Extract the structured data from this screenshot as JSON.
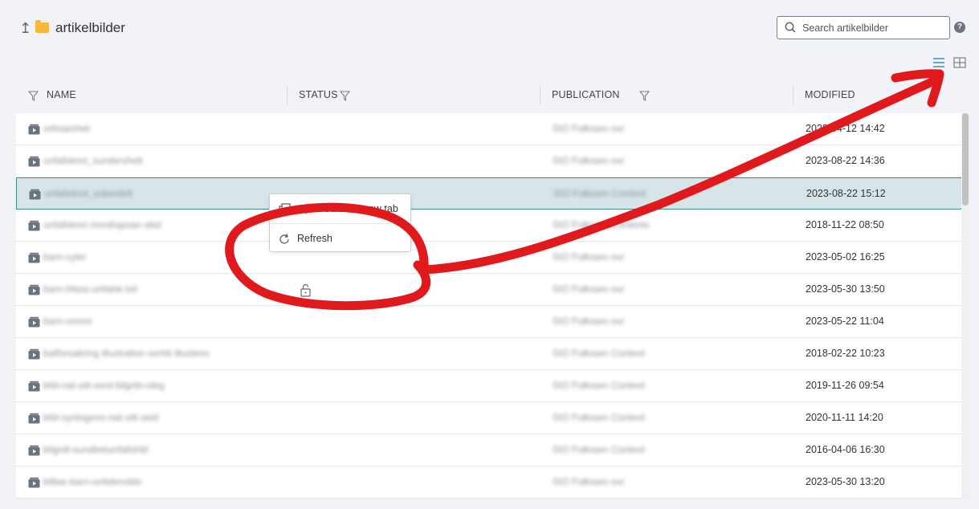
{
  "header": {
    "folder_title": "artikelbilder",
    "up_icon": "arrow-up-icon",
    "folder_icon": "folder-icon"
  },
  "search": {
    "placeholder": "Search artikelbilder",
    "value": ""
  },
  "toolbar": {
    "help_label": "?",
    "list_view_icon": "list-view-icon",
    "grid_view_icon": "grid-view-icon"
  },
  "columns": {
    "name": "NAME",
    "status": "STATUS",
    "publication": "PUBLICATION",
    "modified": "MODIFIED"
  },
  "rows": [
    {
      "name": "virksamhet",
      "publication": "SIO Folksam ovr",
      "modified": "2022-04-12 14:42"
    },
    {
      "name": "unfallskrot_sundervhelt",
      "publication": "SIO Folksam ovr",
      "modified": "2023-08-22 14:36"
    },
    {
      "name": "unfallskrot_sukerdelt",
      "publication": "SIO Folksam Content",
      "modified": "2023-08-22 15:12",
      "selected": true
    },
    {
      "name": "unfallskrot mordrapsan skid",
      "publication": "SIO Folksam Contents",
      "modified": "2018-11-22 08:50"
    },
    {
      "name": "barn-cyler",
      "publication": "SIO Folksam ovr",
      "modified": "2023-05-02 16:25"
    },
    {
      "name": "barn-hfass-unfalsk lsit",
      "publication": "SIO Folksam ovr",
      "modified": "2023-05-30 13:50"
    },
    {
      "name": "barn-vonmi",
      "publication": "SIO Folksam ovr",
      "modified": "2023-05-22 11:04"
    },
    {
      "name": "batforsakring illustration serhb illustens",
      "publication": "SIO Folksam Content",
      "modified": "2018-02-22 10:23"
    },
    {
      "name": "bild-nat-sitt-serd-bilgrbt-rdeg",
      "publication": "SIO Folksam Content",
      "modified": "2019-11-26 09:54"
    },
    {
      "name": "bild-synlogeon-nat-sitt-seld",
      "publication": "SIO Folksam Content",
      "modified": "2020-11-11 14:20"
    },
    {
      "name": "bilgrdt-sundbetunfallshld",
      "publication": "SIO Folksam Content",
      "modified": "2016-04-06 16:30"
    },
    {
      "name": "bilbar-barn-unfalenslds",
      "publication": "SIO Folksam ovr",
      "modified": "2023-05-30 13:20"
    }
  ],
  "context_menu": {
    "open_editor_label": "Open editor in new tab",
    "refresh_label": "Refresh"
  },
  "colors": {
    "background": "#f2f3f8",
    "selected_row": "#d7e5e9",
    "selected_border": "#3d8a8c",
    "accent_icon": "#3a8fb7",
    "annotation_red": "#e0191c",
    "folder": "#f6b73c"
  }
}
